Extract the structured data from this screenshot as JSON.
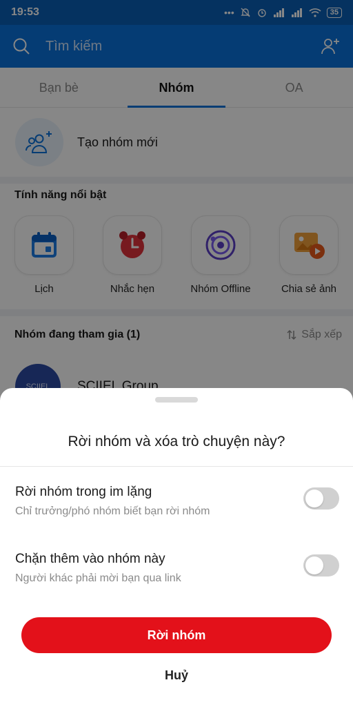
{
  "status_bar": {
    "time": "19:53",
    "battery": "35"
  },
  "header": {
    "search_placeholder": "Tìm kiếm"
  },
  "tabs": [
    {
      "label": "Bạn bè",
      "active": false
    },
    {
      "label": "Nhóm",
      "active": true
    },
    {
      "label": "OA",
      "active": false
    }
  ],
  "create_group": {
    "label": "Tạo nhóm mới"
  },
  "featured": {
    "title": "Tính năng nổi bật",
    "items": [
      {
        "label": "Lịch",
        "icon": "calendar-icon"
      },
      {
        "label": "Nhắc hẹn",
        "icon": "alarm-clock-icon"
      },
      {
        "label": "Nhóm Offline",
        "icon": "orbit-icon"
      },
      {
        "label": "Chia sẻ ảnh",
        "icon": "photo-share-icon"
      }
    ]
  },
  "joined": {
    "title": "Nhóm đang tham gia (1)",
    "sort_label": "Sắp xếp"
  },
  "group_list": [
    {
      "name": "SCIIEL Group",
      "avatar_text": "SCIIEL"
    }
  ],
  "sheet": {
    "title": "Rời nhóm và xóa trò chuyện này?",
    "options": [
      {
        "title": "Rời nhóm trong im lặng",
        "desc": "Chỉ trưởng/phó nhóm biết bạn rời nhóm",
        "on": false
      },
      {
        "title": "Chặn thêm vào nhóm này",
        "desc": "Người khác phải mời bạn qua link",
        "on": false
      }
    ],
    "leave_label": "Rời nhóm",
    "cancel_label": "Huỷ"
  },
  "colors": {
    "primary": "#0b72db",
    "danger": "#e3111a",
    "toggle_off": "#d0d0d0"
  }
}
